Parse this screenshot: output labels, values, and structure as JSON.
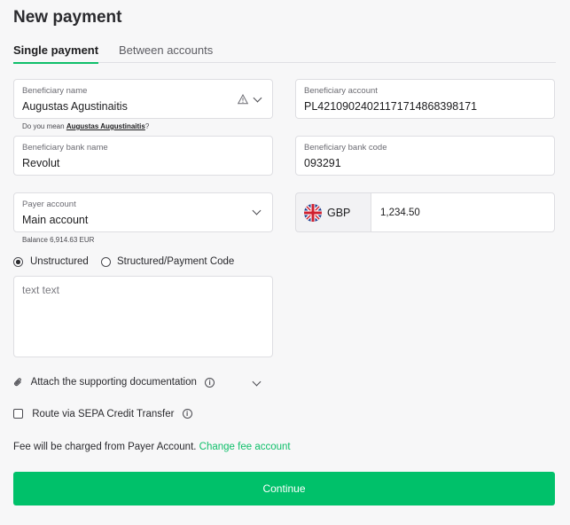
{
  "page": {
    "title": "New payment"
  },
  "tabs": [
    {
      "label": "Single payment",
      "active": true
    },
    {
      "label": "Between accounts",
      "active": false
    }
  ],
  "beneficiary_name": {
    "label": "Beneficiary name",
    "value": "Augustas Agustinaitis",
    "hint_prefix": "Do you mean ",
    "hint_suggestion": "Augustas Augustinaitis",
    "hint_suffix": "?"
  },
  "beneficiary_account": {
    "label": "Beneficiary account",
    "value": "PL42109024021171714868398171"
  },
  "bank_name": {
    "label": "Beneficiary bank name",
    "value": "Revolut"
  },
  "bank_code": {
    "label": "Beneficiary bank code",
    "value": "093291"
  },
  "payer_account": {
    "label": "Payer account",
    "value": "Main account",
    "balance": "Balance 6,914.63 EUR"
  },
  "currency": {
    "code": "GBP",
    "icon": "uk-flag-icon"
  },
  "amount": {
    "value": "1,234.50"
  },
  "payment_type": {
    "options": [
      "Unstructured",
      "Structured/Payment Code"
    ],
    "selected": "Unstructured"
  },
  "message": {
    "placeholder": "text text"
  },
  "attachments": {
    "label": "Attach the supporting documentation"
  },
  "sepa": {
    "label": "Route via SEPA Credit Transfer",
    "checked": false
  },
  "fee": {
    "text": "Fee will be charged from Payer Account.",
    "link": "Change fee account"
  },
  "actions": {
    "continue_label": "Continue"
  },
  "colors": {
    "accent": "#00c16a",
    "background": "#f7f7f8"
  }
}
